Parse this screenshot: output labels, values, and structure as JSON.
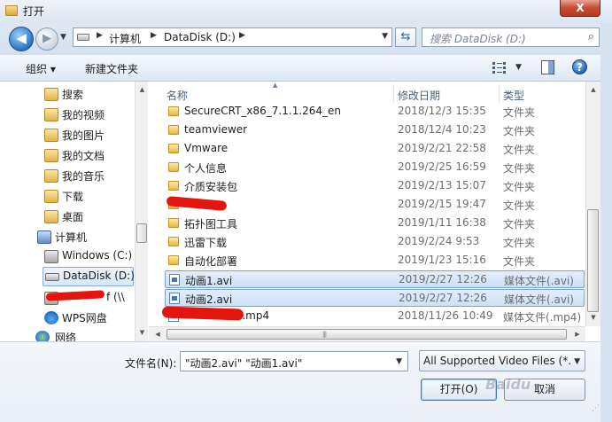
{
  "window": {
    "title": "打开",
    "close_label": "X"
  },
  "nav": {
    "back_glyph": "◀",
    "forward_glyph": "▶",
    "breadcrumb": [
      "计算机",
      "DataDisk (D:)"
    ],
    "search_placeholder": "搜索 DataDisk (D:)"
  },
  "toolbar": {
    "organize_label": "组织 ▾",
    "new_folder_label": "新建文件夹",
    "help_glyph": "?"
  },
  "sidebar": {
    "items": [
      {
        "label": "搜索",
        "icon": "search-folder-icon"
      },
      {
        "label": "我的视频",
        "icon": "video-library-icon"
      },
      {
        "label": "我的图片",
        "icon": "pictures-library-icon"
      },
      {
        "label": "我的文档",
        "icon": "documents-library-icon"
      },
      {
        "label": "我的音乐",
        "icon": "music-library-icon"
      },
      {
        "label": "下载",
        "icon": "downloads-folder-icon"
      },
      {
        "label": "桌面",
        "icon": "desktop-folder-icon"
      },
      {
        "label": "计算机",
        "icon": "computer-icon"
      },
      {
        "label": "Windows (C:)",
        "icon": "drive-c-icon"
      },
      {
        "label": "DataDisk (D:)",
        "icon": "drive-d-icon"
      },
      {
        "label": "f (\\\\",
        "icon": "network-drive-icon"
      },
      {
        "label": "WPS网盘",
        "icon": "wps-cloud-icon"
      },
      {
        "label": "网络",
        "icon": "network-icon"
      }
    ]
  },
  "columns": {
    "name": "名称",
    "date": "修改日期",
    "type": "类型"
  },
  "files": [
    {
      "name": "SecureCRT_x86_7.1.1.264_en",
      "date": "2018/12/3 15:35",
      "type": "文件夹",
      "kind": "folder",
      "selected": false
    },
    {
      "name": "teamviewer",
      "date": "2018/12/4 10:23",
      "type": "文件夹",
      "kind": "folder",
      "selected": false
    },
    {
      "name": "Vmware",
      "date": "2019/2/21 22:58",
      "type": "文件夹",
      "kind": "folder",
      "selected": false
    },
    {
      "name": "个人信息",
      "date": "2019/2/25 16:59",
      "type": "文件夹",
      "kind": "folder",
      "selected": false
    },
    {
      "name": "介质安装包",
      "date": "2019/2/13 15:07",
      "type": "文件夹",
      "kind": "folder",
      "selected": false
    },
    {
      "name": "",
      "date": "2019/2/15 19:47",
      "type": "文件夹",
      "kind": "folder",
      "selected": false
    },
    {
      "name": "拓扑图工具",
      "date": "2019/1/11 16:38",
      "type": "文件夹",
      "kind": "folder",
      "selected": false
    },
    {
      "name": "迅雷下载",
      "date": "2019/2/24 9:53",
      "type": "文件夹",
      "kind": "folder",
      "selected": false
    },
    {
      "name": "自动化部署",
      "date": "2019/1/23 15:16",
      "type": "文件夹",
      "kind": "folder",
      "selected": false
    },
    {
      "name": "动画1.avi",
      "date": "2019/2/27 12:26",
      "type": "媒体文件(.avi)",
      "kind": "video",
      "selected": true
    },
    {
      "name": "动画2.avi",
      "date": "2019/2/27 12:26",
      "type": "媒体文件(.avi)",
      "kind": "video",
      "selected": true
    },
    {
      "name": "l.mp4",
      "date": "2018/11/26 10:49",
      "type": "媒体文件(.mp4)",
      "kind": "video",
      "selected": false
    }
  ],
  "footer": {
    "filename_label": "文件名(N):",
    "filename_value": "\"动画2.avi\" \"动画1.avi\"",
    "filter_value": "All Supported Video Files (*.",
    "open_label": "打开(O)",
    "cancel_label": "取消",
    "watermark": "Baidu"
  }
}
